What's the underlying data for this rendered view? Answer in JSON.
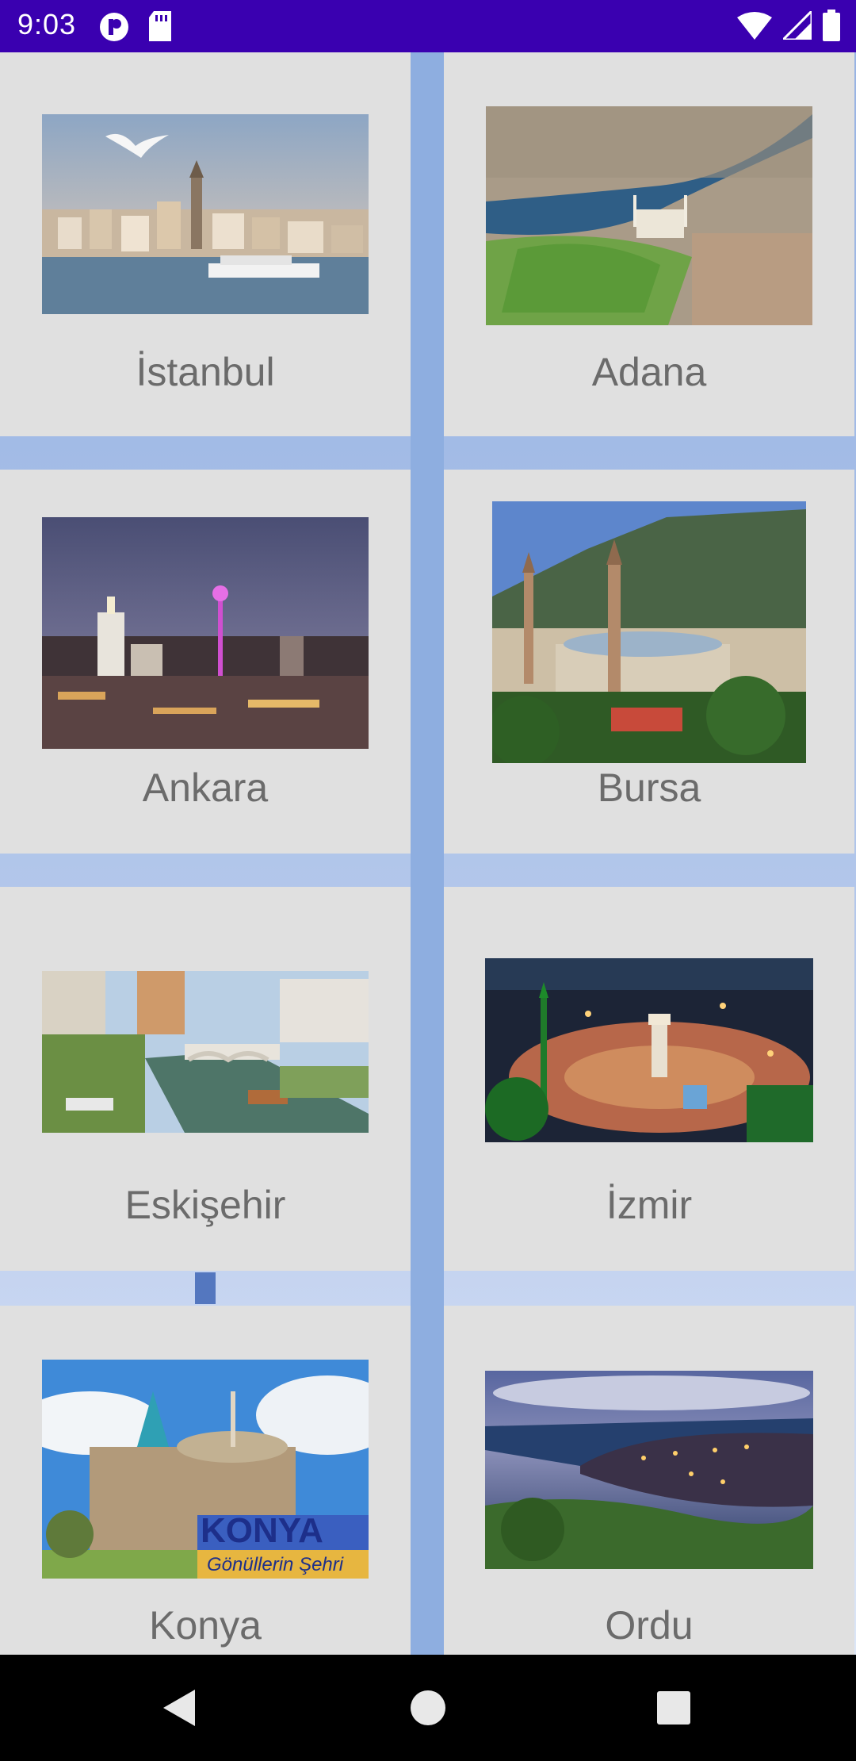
{
  "status_bar": {
    "time": "9:03",
    "icons_left": [
      "notification-p-icon",
      "sd-card-icon"
    ],
    "icons_right": [
      "wifi-icon",
      "cell-signal-icon",
      "battery-icon"
    ]
  },
  "cities": [
    {
      "name": "İstanbul",
      "image": "istanbul-photo"
    },
    {
      "name": "Adana",
      "image": "adana-photo"
    },
    {
      "name": "Ankara",
      "image": "ankara-photo"
    },
    {
      "name": "Bursa",
      "image": "bursa-photo"
    },
    {
      "name": "Eskişehir",
      "image": "eskisehir-photo"
    },
    {
      "name": "İzmir",
      "image": "izmir-photo"
    },
    {
      "name": "Konya",
      "image": "konya-photo"
    },
    {
      "name": "Ordu",
      "image": "ordu-photo"
    }
  ],
  "konya_sign": {
    "title": "KONYA",
    "subtitle": "Gönüllerin Şehri"
  },
  "nav_bar": {
    "buttons": [
      "back-icon",
      "home-icon",
      "recents-icon"
    ]
  },
  "colors": {
    "status_bar": "#3a00b0",
    "card": "#e0e0e0",
    "label": "#6b6b6b",
    "background": "#9fb6e0"
  }
}
